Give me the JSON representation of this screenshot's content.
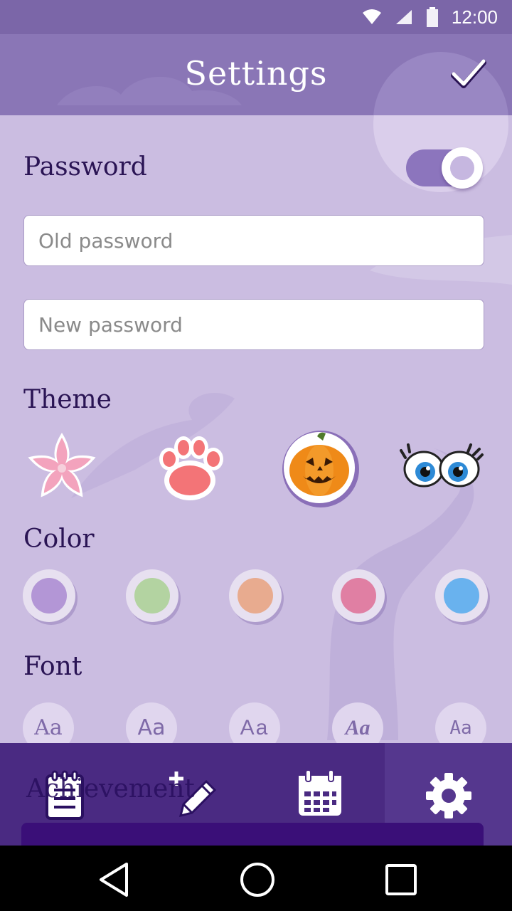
{
  "status_bar": {
    "time": "12:00"
  },
  "app_bar": {
    "title": "Settings"
  },
  "password": {
    "label": "Password",
    "enabled": true,
    "old_placeholder": "Old password",
    "new_placeholder": "New password"
  },
  "theme": {
    "label": "Theme",
    "items": [
      {
        "name": "flower-icon"
      },
      {
        "name": "paw-icon"
      },
      {
        "name": "pumpkin-icon"
      },
      {
        "name": "eyes-icon"
      }
    ],
    "selected": 2
  },
  "color": {
    "label": "Color",
    "options": [
      "#b396d6",
      "#b3d3a1",
      "#e8ab8f",
      "#e07fa3",
      "#69b2ee"
    ]
  },
  "font": {
    "label": "Font",
    "options": [
      "Aa",
      "Aa",
      "Aa",
      "Aa",
      "Aa"
    ]
  },
  "achievement": {
    "label": "Achievement"
  },
  "bottom_nav": {
    "items": [
      "notebook-icon",
      "new-entry-icon",
      "calendar-icon",
      "settings-icon"
    ],
    "active": 3
  },
  "system_nav": [
    "back-icon",
    "home-icon",
    "recents-icon"
  ]
}
